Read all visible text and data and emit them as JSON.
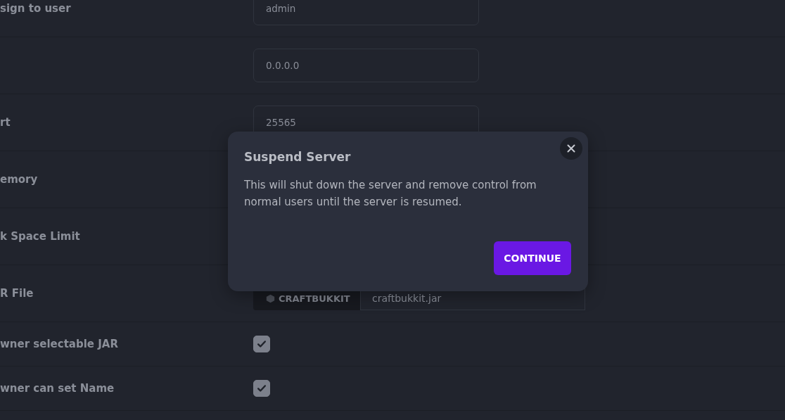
{
  "rows": [
    {
      "kind": "text",
      "label": "sign to user",
      "value": "admin"
    },
    {
      "kind": "text",
      "value": "0.0.0.0"
    },
    {
      "kind": "text",
      "label": "rt",
      "value": "25565"
    },
    {
      "kind": "text",
      "label": "emory"
    },
    {
      "kind": "text",
      "label": "k Space Limit"
    },
    {
      "kind": "jar",
      "label": "R File",
      "addon": "CRAFTBUKKIT",
      "value": "craftbukkit.jar"
    },
    {
      "kind": "check",
      "label": "wner selectable JAR",
      "checked": true
    },
    {
      "kind": "check",
      "label": "wner can set Name",
      "checked": true
    }
  ],
  "modal": {
    "title": "Suspend Server",
    "body": "This will shut down the server and remove control from normal users until the server is resumed.",
    "button": "CONTINUE"
  }
}
